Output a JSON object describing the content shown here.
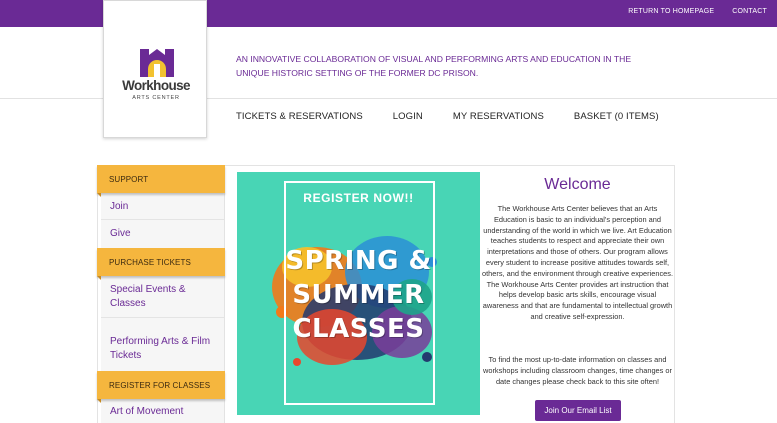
{
  "topbar": {
    "links": [
      "RETURN TO HOMEPAGE",
      "CONTACT"
    ],
    "background_color": "#6a2a95"
  },
  "logo": {
    "name": "Workhouse",
    "subtitle": "ARTS CENTER",
    "icon": "workhouse-logo-icon"
  },
  "tagline": "AN INNOVATIVE COLLABORATION OF VISUAL AND PERFORMING ARTS AND EDUCATION IN THE UNIQUE HISTORIC SETTING OF THE FORMER DC PRISON.",
  "main_nav": [
    "TICKETS & RESERVATIONS",
    "LOGIN",
    "MY RESERVATIONS",
    "BASKET (0 ITEMS)"
  ],
  "sidebar": {
    "sections": [
      {
        "title": "SUPPORT",
        "links": [
          "Join",
          "Give"
        ]
      },
      {
        "title": "PURCHASE TICKETS",
        "links": [
          "Special Events & Classes",
          "Performing Arts & Film Tickets"
        ]
      },
      {
        "title": "REGISTER FOR CLASSES",
        "links": [
          "Art of Movement"
        ]
      }
    ]
  },
  "promo": {
    "register": "REGISTER NOW!!",
    "headline_lines": [
      "SPRING &",
      "SUMMER",
      "CLASSES"
    ]
  },
  "welcome": {
    "title": "Welcome",
    "paragraph1": "The Workhouse Arts Center believes that an Arts Education is basic to an individual's perception and understanding of the world in which we live. Art Education teaches students to respect and appreciate their own interpretations and those of others. Our program allows every student to increase positive attitudes towards self, others, and the environment through creative experiences. The Workhouse Arts Center provides art instruction that helps develop basic arts skills, encourage visual awareness and that are fundamental to intellectual growth and creative self-expression.",
    "paragraph2": "To find the most up-to-date information on classes and workshops including classroom changes, time changes or date changes please check back to this site often!",
    "button": "Join Our Email List"
  },
  "colors": {
    "brand_purple": "#6a2a95",
    "sidebar_orange": "#f5b63e",
    "promo_teal": "#48d5b5"
  }
}
